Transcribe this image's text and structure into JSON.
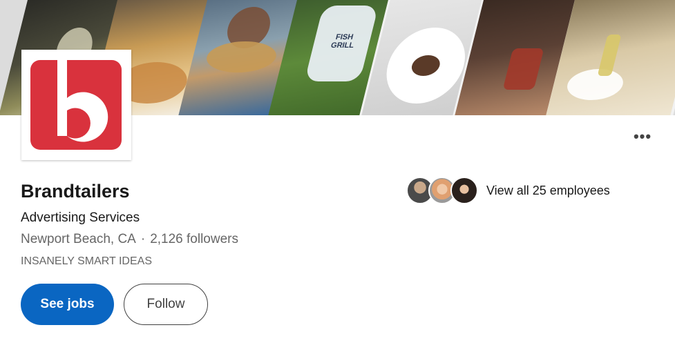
{
  "company": {
    "name": "Brandtailers",
    "industry": "Advertising Services",
    "location": "Newport Beach, CA",
    "separator": "·",
    "followers": "2,126 followers",
    "tagline": "INSANELY SMART IDEAS"
  },
  "actions": {
    "primary_label": "See jobs",
    "secondary_label": "Follow",
    "more_label": "•••"
  },
  "employees": {
    "label": "View all 25 employees"
  },
  "banner": {
    "bag_text": "FISH GRILL"
  },
  "colors": {
    "brand_red": "#d9323d",
    "primary_button": "#0a66c2",
    "muted_text": "#666666"
  },
  "icons": {
    "logo": "brandtailers-b-logo",
    "more": "more-horizontal-icon"
  }
}
